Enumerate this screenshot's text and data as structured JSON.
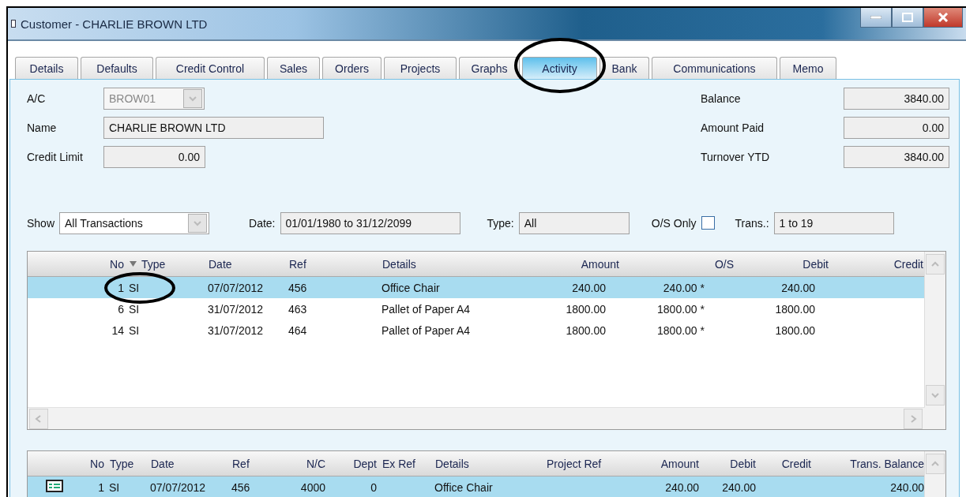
{
  "window": {
    "title": "Customer - CHARLIE BROWN LTD"
  },
  "tabs": [
    {
      "label": "Details",
      "selected": false
    },
    {
      "label": "Defaults",
      "selected": false
    },
    {
      "label": "Credit Control",
      "selected": false
    },
    {
      "label": "Sales",
      "selected": false
    },
    {
      "label": "Orders",
      "selected": false
    },
    {
      "label": "Projects",
      "selected": false
    },
    {
      "label": "Graphs",
      "selected": false
    },
    {
      "label": "Activity",
      "selected": true
    },
    {
      "label": "Bank",
      "selected": false
    },
    {
      "label": "Communications",
      "selected": false
    },
    {
      "label": "Memo",
      "selected": false
    }
  ],
  "account_fields": [
    {
      "kind": "dropdown",
      "label": "A/C",
      "value": "BROW01"
    },
    {
      "kind": "text",
      "label": "Name",
      "value": "CHARLIE BROWN LTD"
    },
    {
      "kind": "number",
      "label": "Credit Limit",
      "value": "0.00"
    }
  ],
  "totals": [
    {
      "label": "Balance",
      "value": "3840.00"
    },
    {
      "label": "Amount Paid",
      "value": "0.00"
    },
    {
      "label": "Turnover YTD",
      "value": "3840.00"
    }
  ],
  "filters": {
    "show": {
      "label": "Show",
      "value": "All Transactions"
    },
    "date": {
      "label": "Date:",
      "value": "01/01/1980 to 31/12/2099"
    },
    "type": {
      "label": "Type:",
      "value": "All"
    },
    "os_only": {
      "label": "O/S Only",
      "checked": false
    },
    "trans": {
      "label": "Trans.:",
      "value": "1 to 19"
    }
  },
  "transactions": {
    "columns": [
      {
        "label": "No",
        "sorted": false
      },
      {
        "label": "Type",
        "sorted": true
      },
      {
        "label": "Date",
        "sorted": false
      },
      {
        "label": "Ref",
        "sorted": false
      },
      {
        "label": "Details",
        "sorted": false
      },
      {
        "label": "Amount",
        "sorted": false
      },
      {
        "label": "O/S",
        "sorted": false
      },
      {
        "label": "Debit",
        "sorted": false
      },
      {
        "label": "Credit",
        "sorted": false
      }
    ],
    "rows": [
      {
        "selected": true,
        "cells": [
          "1",
          "SI",
          "07/07/2012",
          "456",
          "Office Chair",
          "240.00",
          "240.00 *",
          "240.00",
          ""
        ]
      },
      {
        "selected": false,
        "cells": [
          "6",
          "SI",
          "31/07/2012",
          "463",
          "Pallet of Paper A4",
          "1800.00",
          "1800.00 *",
          "1800.00",
          ""
        ]
      },
      {
        "selected": false,
        "cells": [
          "14",
          "SI",
          "31/07/2012",
          "464",
          "Pallet of Paper A4",
          "1800.00",
          "1800.00 *",
          "1800.00",
          ""
        ]
      }
    ]
  },
  "splits": {
    "columns": [
      "No",
      "Type",
      "Date",
      "Ref",
      "N/C",
      "Dept",
      "Ex Ref",
      "Details",
      "Project Ref",
      "Amount",
      "Debit",
      "Credit",
      "Trans. Balance"
    ],
    "rows": [
      {
        "selected": true,
        "cells": [
          "1",
          "SI",
          "07/07/2012",
          "456",
          "4000",
          "0",
          "",
          "Office Chair",
          "",
          "240.00",
          "240.00",
          "",
          "240.00"
        ]
      }
    ]
  }
}
